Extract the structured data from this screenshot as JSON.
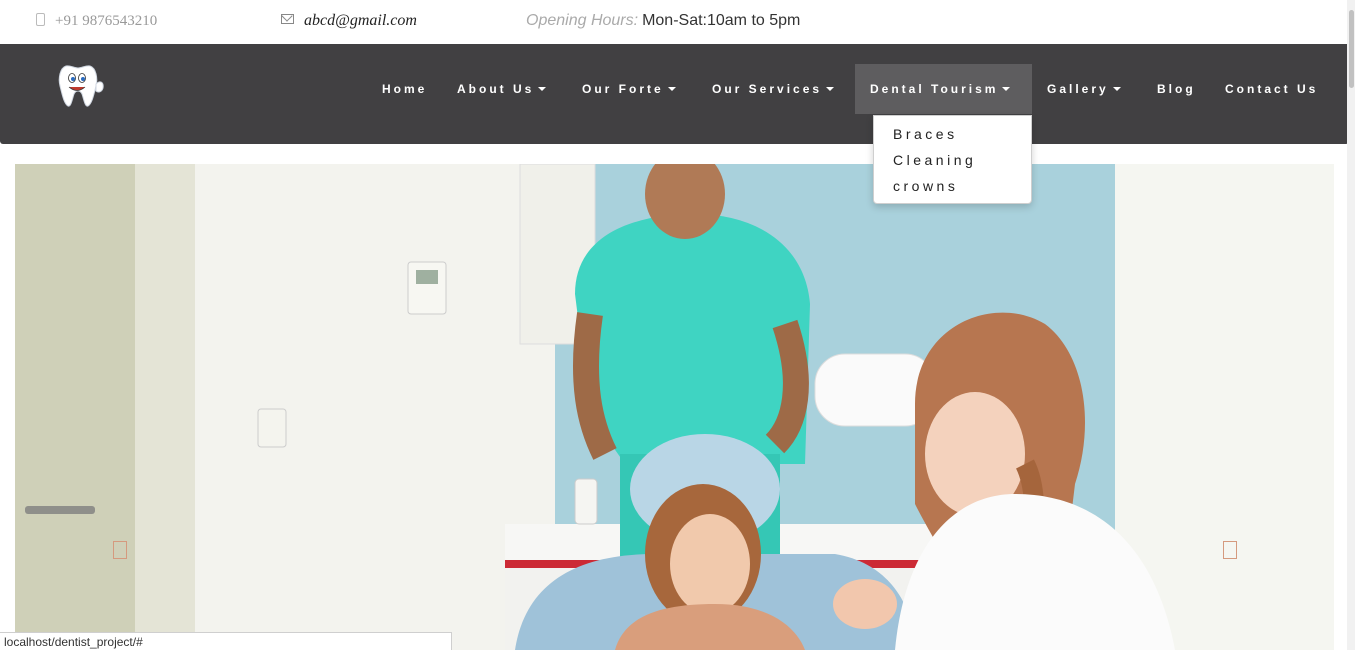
{
  "topbar": {
    "phone": "+91 9876543210",
    "email": "abcd@gmail.com",
    "hours_label": "Opening Hours:",
    "hours_value": "Mon-Sat:10am to 5pm"
  },
  "nav": {
    "items": [
      {
        "label": "Home",
        "has_caret": false
      },
      {
        "label": "About Us",
        "has_caret": true
      },
      {
        "label": "Our Forte",
        "has_caret": true
      },
      {
        "label": "Our Services",
        "has_caret": true
      },
      {
        "label": "Dental Tourism",
        "has_caret": true,
        "active": true
      },
      {
        "label": "Gallery",
        "has_caret": true
      },
      {
        "label": "Blog",
        "has_caret": false
      },
      {
        "label": "Contact Us",
        "has_caret": false
      }
    ]
  },
  "dropdown": {
    "items": [
      "Braces",
      "Cleaning",
      "crowns"
    ]
  },
  "status_url": "localhost/dentist_project/#",
  "colors": {
    "navbar": "#414042",
    "nav_active": "#5e5d5f",
    "arrow": "#d59a7e"
  },
  "icons": [
    "phone-icon",
    "mail-icon",
    "tooth-logo",
    "caret-down-icon",
    "prev-arrow-icon",
    "next-arrow-icon"
  ]
}
